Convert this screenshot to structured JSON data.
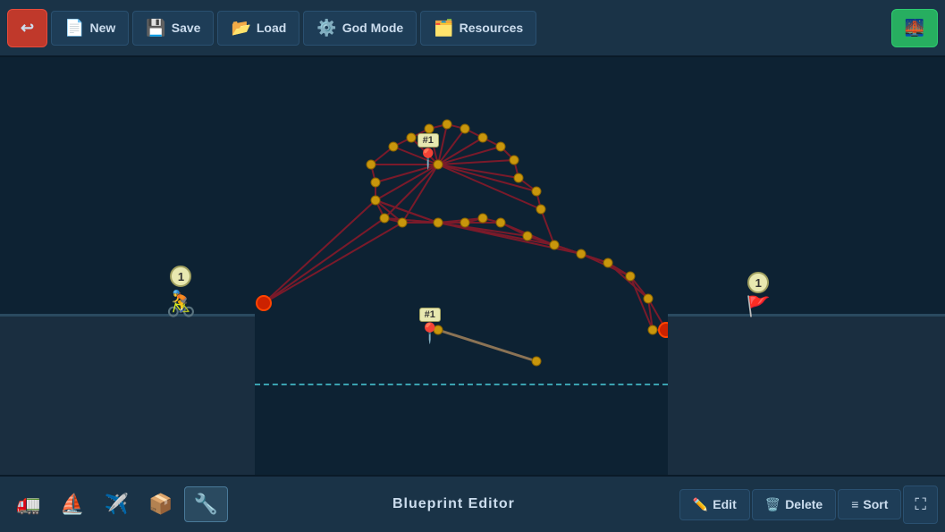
{
  "toolbar": {
    "back_label": "←",
    "new_label": "New",
    "save_label": "Save",
    "load_label": "Load",
    "god_mode_label": "God Mode",
    "resources_label": "Resources",
    "green_btn_icon": "🌉"
  },
  "canvas": {
    "character_number": "1",
    "flag_number": "1",
    "pin1_label": "#1",
    "pin2_label": "#1",
    "water_visible": true
  },
  "bottom_toolbar": {
    "blueprint_label": "Blueprint Editor",
    "edit_label": "Edit",
    "delete_label": "Delete",
    "sort_label": "Sort",
    "tools": [
      {
        "icon": "🚛",
        "name": "truck"
      },
      {
        "icon": "⛵",
        "name": "boat"
      },
      {
        "icon": "✈️",
        "name": "plane"
      },
      {
        "icon": "📦",
        "name": "packages"
      },
      {
        "icon": "🔧",
        "name": "tool"
      }
    ]
  }
}
